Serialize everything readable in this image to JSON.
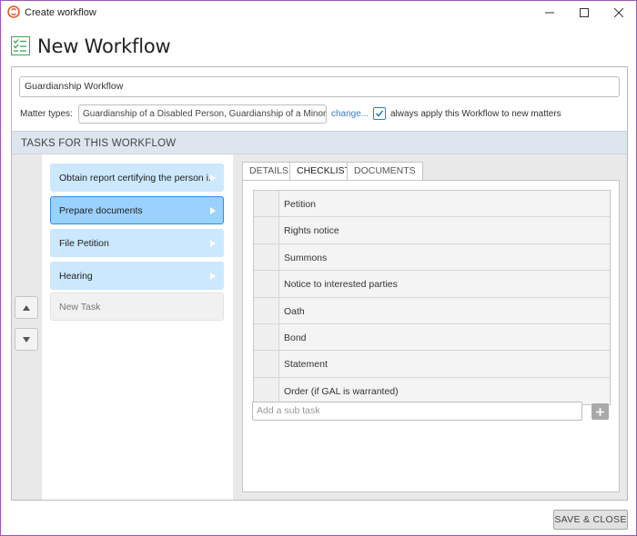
{
  "window": {
    "title": "Create workflow"
  },
  "header": {
    "title": "New Workflow"
  },
  "workflow": {
    "name": "Guardianship Workflow",
    "matter_types_label": "Matter types:",
    "matter_types_value": "Guardianship of a Disabled Person, Guardianship of a Minor",
    "change_link": "change...",
    "always_apply_checked": true,
    "always_apply_label": "always apply this Workflow to new matters"
  },
  "section": {
    "title": "TASKS FOR THIS WORKFLOW"
  },
  "tasks": [
    {
      "label": "Obtain report certifying the person i...",
      "selected": false
    },
    {
      "label": "Prepare documents",
      "selected": true
    },
    {
      "label": "File Petition",
      "selected": false
    },
    {
      "label": "Hearing",
      "selected": false
    }
  ],
  "new_task_placeholder": "New Task",
  "tabs": [
    {
      "label": "DETAILS",
      "active": false
    },
    {
      "label": "CHECKLIST",
      "active": true
    },
    {
      "label": "DOCUMENTS",
      "active": false
    }
  ],
  "checklist": [
    "Petition",
    "Rights notice",
    "Summons",
    "Notice to interested parties",
    "Oath",
    "Bond",
    "Statement",
    "Order (if GAL is warranted)"
  ],
  "subtask_placeholder": "Add a sub task",
  "footer": {
    "save_close": "SAVE & CLOSE"
  },
  "colors": {
    "accent": "#2f8ee8",
    "task_bg": "#cce8ff",
    "task_selected_bg": "#99d1ff",
    "section_bg": "#dde6ee",
    "link": "#2f7fd1",
    "window_border": "#9b59b6"
  },
  "icons": {
    "app": "clio-s-icon",
    "header": "checklist-icon",
    "minimize": "minimize-icon",
    "maximize": "maximize-icon",
    "close": "close-icon",
    "move_up": "triangle-up-icon",
    "move_down": "triangle-down-icon",
    "task_arrow": "chevron-right-icon",
    "add": "plus-icon",
    "checkbox": "checkmark-icon"
  }
}
